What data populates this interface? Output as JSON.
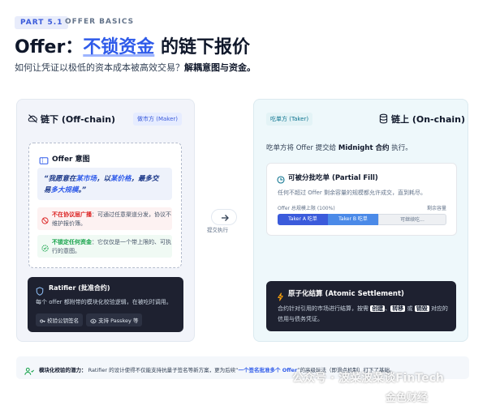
{
  "header": {
    "part": "PART 5.1",
    "section": "OFFER BASICS",
    "title_prefix": "Offer：",
    "title_highlight": "不锁资金",
    "title_suffix": "的链下报价",
    "subtitle_lead": "如何让凭证以极低的资本成本被高效交易？",
    "subtitle_bold": "解耦意图与资金。"
  },
  "left": {
    "title": "链下 (Off-chain)",
    "badge": "做市方 (Maker)",
    "intent_title": "Offer 意图",
    "quote_a": "“我愿意在",
    "quote_hl1": "某市场",
    "quote_b": "，以",
    "quote_hl2": "某价格",
    "quote_c": "，最多交易",
    "quote_hl3": "多大规模",
    "quote_d": "。”",
    "warn1_bold": "不在协议层广播",
    "warn1_text": "：可通过任意渠道分发，协议不维护报价簿。",
    "warn2_bold": "不锁定任何资金",
    "warn2_text": "：它仅仅是一个带上限的、可执行的意图。",
    "ratifier_title": "Ratifier (批准合约)",
    "ratifier_desc": "每个 offer 都附带的模块化校验逻辑，在被吃时调用。",
    "chip1": "校验公钥签名",
    "chip2": "支持 Passkey 等"
  },
  "middle": {
    "label": "提交执行"
  },
  "right": {
    "badge": "吃单方 (Taker)",
    "title": "链上 (On-chain)",
    "desc_a": "吃单方将 Offer 提交给",
    "desc_bold": "Midnight 合约",
    "desc_b": "执行。",
    "pf_title": "可被分批吃单 (Partial Fill)",
    "pf_desc": "任何不超过 Offer 剩余容量的规模都允许成交，直到耗尽。",
    "pf_label_total": "Offer 总规模上限 (100%)",
    "pf_label_remaining": "剩余容量",
    "bar_a": "Taker A 吃单",
    "bar_b": "Taker B 吃单",
    "bar_c": "可继续吃...",
    "fill": {
      "taker_a": 0.3,
      "taker_b": 0.3,
      "remaining": 0.4
    },
    "atomic_title": "原子化结算 (Atomic Settlement)",
    "atomic_a": "合约针对引用的市场进行结算，按需",
    "atomic_w1": "创建",
    "atomic_w2": "转移",
    "atomic_w3": "销毁",
    "atomic_b": "对应的信用与债务凭证。",
    "atomic_sep1": "、",
    "atomic_sep2": "或"
  },
  "footer": {
    "lead": "模块化校验的潜力：",
    "text_a": "Ratifier 的设计使得不仅能支持抗量子签名等新方案，更为后续“",
    "link": "一个签名批准多个 Offer",
    "text_b": "”的高级玩法（即滑点机制）打下了基础。"
  },
  "watermark": {
    "line1": "公众号 · 波菜波菜谈FinTech",
    "line2": "金色财经"
  },
  "colors": {
    "accent": "#2f5bea",
    "dark_card": "#1e2130",
    "teal": "#0e7490",
    "warning_red": "#dc2626",
    "ok_green": "#16a34a"
  },
  "icons": [
    "cloud-off-icon",
    "ticket-icon",
    "ban-icon",
    "unlock-icon",
    "shield-icon",
    "key-icon",
    "eye-icon",
    "arrow-right-icon",
    "database-icon",
    "pie-clock-icon",
    "bolt-icon",
    "users-icon"
  ]
}
